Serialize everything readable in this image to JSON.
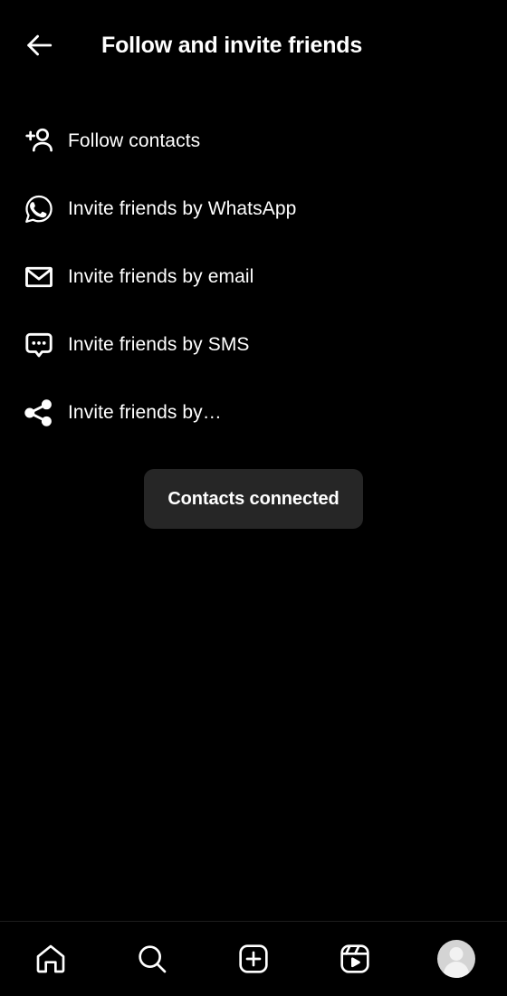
{
  "header": {
    "title": "Follow and invite friends",
    "back_icon": "arrow-left-icon"
  },
  "menu": {
    "items": [
      {
        "label": "Follow contacts",
        "icon": "person-add-icon"
      },
      {
        "label": "Invite friends by WhatsApp",
        "icon": "whatsapp-icon"
      },
      {
        "label": "Invite friends by email",
        "icon": "envelope-icon"
      },
      {
        "label": "Invite friends by SMS",
        "icon": "message-bubble-icon"
      },
      {
        "label": "Invite friends by…",
        "icon": "share-nodes-icon"
      }
    ]
  },
  "toast": {
    "message": "Contacts connected",
    "background_color": "#262626",
    "text_color": "#ffffff"
  },
  "bottom_nav": {
    "items": [
      {
        "name": "home",
        "icon": "home-icon"
      },
      {
        "name": "search",
        "icon": "search-icon"
      },
      {
        "name": "create",
        "icon": "plus-square-icon"
      },
      {
        "name": "reels",
        "icon": "reels-icon"
      },
      {
        "name": "profile",
        "icon": "avatar-icon"
      }
    ]
  },
  "theme": {
    "background": "#000000",
    "foreground": "#ffffff",
    "divider": "#1e1e1e"
  }
}
